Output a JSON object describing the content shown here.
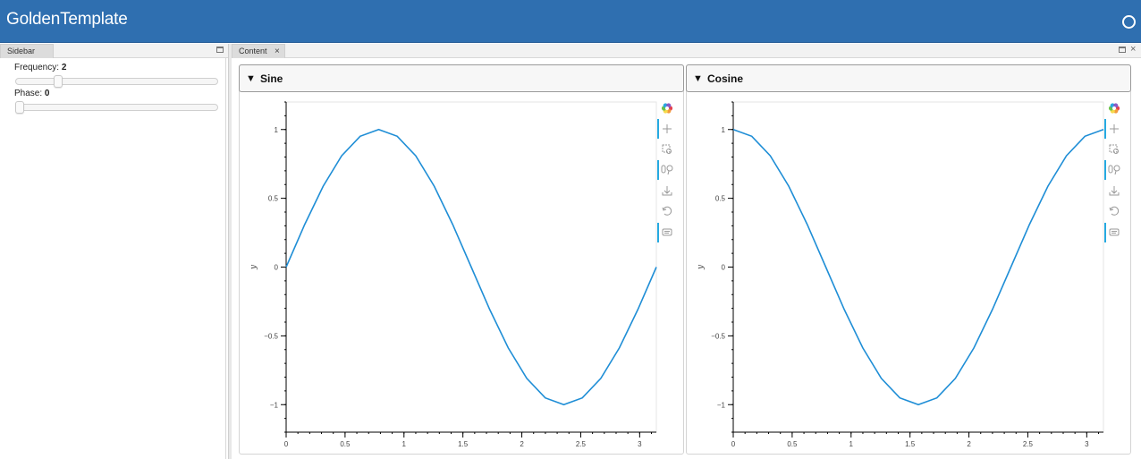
{
  "header": {
    "title": "GoldenTemplate",
    "busy_indicator": "busy-idle-circle"
  },
  "sidebar": {
    "tab_label": "Sidebar",
    "frequency": {
      "label": "Frequency: ",
      "value": "2",
      "slider_min": 0,
      "slider_max": 10,
      "slider_value": 2
    },
    "phase": {
      "label": "Phase: ",
      "value": "0",
      "slider_min": 0,
      "slider_max": 3.14,
      "slider_value": 0
    }
  },
  "content": {
    "tab_label": "Content",
    "tab_close": "×"
  },
  "cards": [
    {
      "title": "Sine",
      "toggle": "▼"
    },
    {
      "title": "Cosine",
      "toggle": "▼"
    }
  ],
  "accent_color": "#2f6fb0",
  "line_color": "#1f8ed6",
  "toolbar_icons": [
    "bokeh-logo-icon",
    "pan-icon",
    "box-zoom-icon",
    "wheel-zoom-icon",
    "save-icon",
    "reset-icon",
    "hover-icon"
  ],
  "chart_data": [
    {
      "type": "line",
      "title": "",
      "xlabel": "",
      "ylabel": "y",
      "xlim": [
        0,
        3.14159
      ],
      "ylim": [
        -1.2,
        1.2
      ],
      "xticks": [
        0,
        0.5,
        1,
        1.5,
        2,
        2.5,
        3
      ],
      "xtick_labels": [
        "0",
        "0.5",
        "1",
        "1.5",
        "2",
        "2.5",
        "3"
      ],
      "yticks": [
        -1,
        -0.5,
        0,
        0.5,
        1
      ],
      "ytick_labels": [
        "−1",
        "−0.5",
        "0",
        "0.5",
        "1"
      ],
      "x": [
        0,
        0.1571,
        0.3142,
        0.4712,
        0.6283,
        0.7854,
        0.9425,
        1.0996,
        1.2566,
        1.4137,
        1.5708,
        1.7279,
        1.885,
        2.042,
        2.1991,
        2.3562,
        2.5133,
        2.6704,
        2.8274,
        2.9845,
        3.1416
      ],
      "y": [
        0,
        0.309,
        0.5878,
        0.809,
        0.9511,
        1,
        0.9511,
        0.809,
        0.5878,
        0.309,
        0,
        -0.309,
        -0.5878,
        -0.809,
        -0.9511,
        -1,
        -0.9511,
        -0.809,
        -0.5878,
        -0.309,
        0
      ]
    },
    {
      "type": "line",
      "title": "",
      "xlabel": "",
      "ylabel": "y",
      "xlim": [
        0,
        3.14159
      ],
      "ylim": [
        -1.2,
        1.2
      ],
      "xticks": [
        0,
        0.5,
        1,
        1.5,
        2,
        2.5,
        3
      ],
      "xtick_labels": [
        "0",
        "0.5",
        "1",
        "1.5",
        "2",
        "2.5",
        "3"
      ],
      "yticks": [
        -1,
        -0.5,
        0,
        0.5,
        1
      ],
      "ytick_labels": [
        "−1",
        "−0.5",
        "0",
        "0.5",
        "1"
      ],
      "x": [
        0,
        0.1571,
        0.3142,
        0.4712,
        0.6283,
        0.7854,
        0.9425,
        1.0996,
        1.2566,
        1.4137,
        1.5708,
        1.7279,
        1.885,
        2.042,
        2.1991,
        2.3562,
        2.5133,
        2.6704,
        2.8274,
        2.9845,
        3.1416
      ],
      "y": [
        1,
        0.9511,
        0.809,
        0.5878,
        0.309,
        0,
        -0.309,
        -0.5878,
        -0.809,
        -0.9511,
        -1,
        -0.9511,
        -0.809,
        -0.5878,
        -0.309,
        0,
        0.309,
        0.5878,
        0.809,
        0.9511,
        1
      ]
    }
  ]
}
